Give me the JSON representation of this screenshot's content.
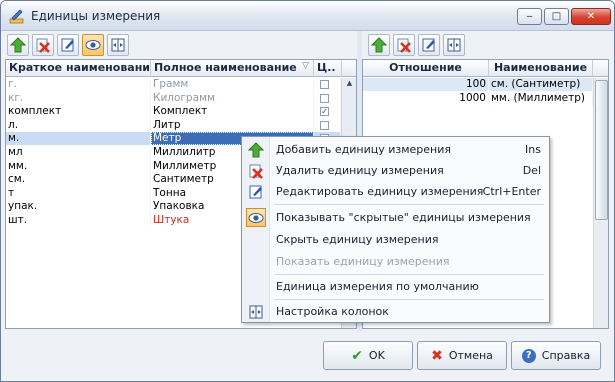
{
  "window": {
    "title": "Единицы измерения",
    "minimize": "‒",
    "maximize": "□",
    "close": "✕"
  },
  "left_grid": {
    "headers": {
      "short": "Краткое наименование",
      "full": "Полное наименование",
      "flag": "Ц.."
    },
    "rows": [
      {
        "short": "г.",
        "full": "Грамм",
        "checked": false,
        "style": "gray"
      },
      {
        "short": "кг.",
        "full": "Килограмм",
        "checked": false,
        "style": "gray"
      },
      {
        "short": "комплект",
        "full": "Комплект",
        "checked": true,
        "style": ""
      },
      {
        "short": "л.",
        "full": "Литр",
        "checked": false,
        "style": ""
      },
      {
        "short": "м.",
        "full": "Метр",
        "checked": false,
        "style": "sel"
      },
      {
        "short": "мл",
        "full": "Миллилитр",
        "checked": false,
        "style": ""
      },
      {
        "short": "мм.",
        "full": "Миллиметр",
        "checked": false,
        "style": ""
      },
      {
        "short": "см.",
        "full": "Сантиметр",
        "checked": false,
        "style": ""
      },
      {
        "short": "т",
        "full": "Тонна",
        "checked": false,
        "style": ""
      },
      {
        "short": "упак.",
        "full": "Упаковка",
        "checked": false,
        "style": ""
      },
      {
        "short": "шт.",
        "full": "Штука",
        "checked": false,
        "style": "red"
      }
    ]
  },
  "right_grid": {
    "headers": {
      "ratio": "Отношение",
      "name": "Наименование"
    },
    "rows": [
      {
        "ratio": "100",
        "name": "см. (Сантиметр)"
      },
      {
        "ratio": "1000",
        "name": "мм. (Миллиметр)"
      }
    ]
  },
  "context_menu": {
    "add": {
      "label": "Добавить единицу измерения",
      "key": "Ins"
    },
    "delete": {
      "label": "Удалить единицу измерения",
      "key": "Del"
    },
    "edit": {
      "label": "Редактировать единицу измерения",
      "key": "Ctrl+Enter"
    },
    "show_hidden": {
      "label": "Показывать \"скрытые\" единицы измерения"
    },
    "hide": {
      "label": "Скрыть единицу измерения"
    },
    "show": {
      "label": "Показать единицу измерения"
    },
    "default": {
      "label": "Единица измерения по умолчанию"
    },
    "columns": {
      "label": "Настройка колонок"
    }
  },
  "buttons": {
    "ok": "OK",
    "cancel": "Отмена",
    "help": "Справка"
  },
  "colors": {
    "accent": "#3d6db4",
    "selection": "#c9dcf3",
    "red_text": "#d52b1e"
  }
}
